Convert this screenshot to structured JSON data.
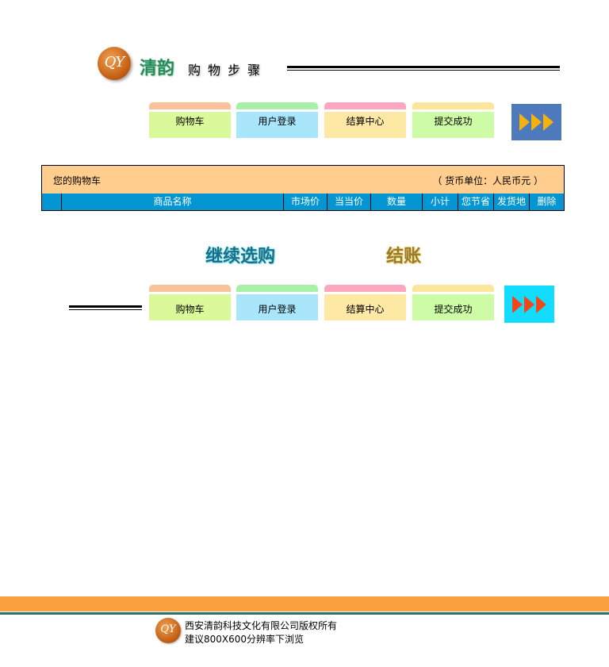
{
  "header": {
    "logo_text": "QY",
    "brand": "清韵",
    "subtitle": "购物步骤"
  },
  "steps": [
    "购物车",
    "用户登录",
    "结算中心",
    "提交成功"
  ],
  "cart": {
    "title": "您的购物车",
    "currency": "（ 货币单位：人民币元 ）",
    "columns": [
      "",
      "商品名称",
      "市场价",
      "当当价",
      "数量",
      "小计",
      "您节省",
      "发货地",
      "删除"
    ]
  },
  "actions": {
    "continue_label": "继续选购",
    "checkout_label": "结账"
  },
  "footer": {
    "logo_text": "QY",
    "copyright": "西安清韵科技文化有限公司版权所有",
    "resolution_note": "建议800X600分辨率下浏览"
  },
  "colors": {
    "accent_orange": "#f9a23d",
    "table_header_blue": "#0496d2",
    "cart_head_bg": "#ffce8f",
    "arrow_box_top": "#4f79bd",
    "arrow_top": "#f5b10c",
    "arrow_box_bottom": "#12dcff",
    "arrow_bottom": "#f2471a"
  }
}
